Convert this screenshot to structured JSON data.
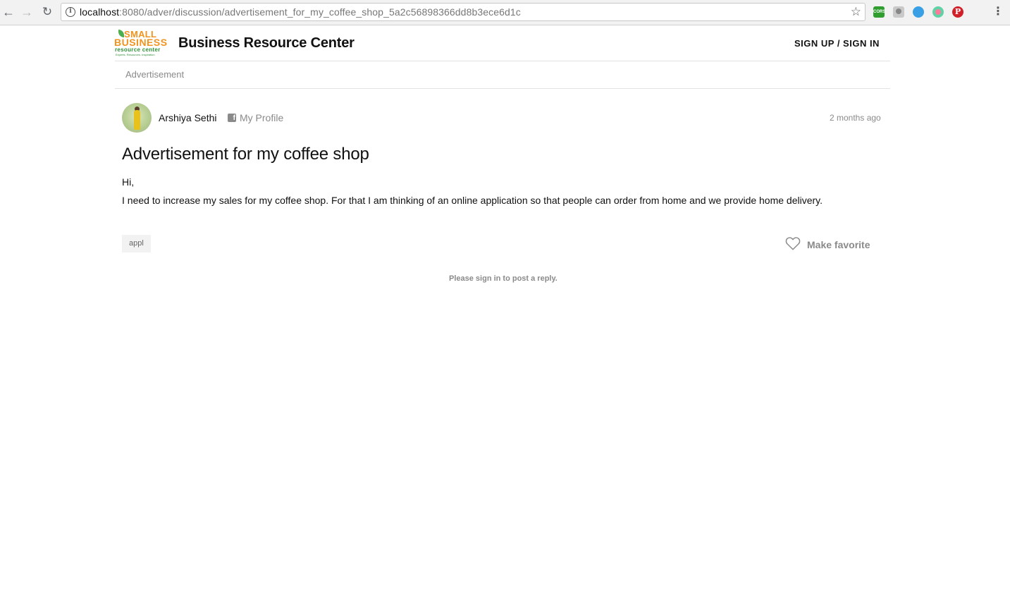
{
  "browser": {
    "url_host": "localhost",
    "url_path": ":8080/adver/discussion/advertisement_for_my_coffee_shop_5a2c56898366dd8b3ece6d1c",
    "ext1_label": "CORS",
    "ext5_label": "P",
    "icons": [
      "back-arrow-icon",
      "forward-arrow-icon",
      "reload-icon",
      "info-icon",
      "star-icon",
      "kebab-menu-icon"
    ]
  },
  "header": {
    "logo": {
      "line1": "SMALL",
      "line2": "BUSINESS",
      "line3": "resource center",
      "line4": "Experts. Resources. Inspiration"
    },
    "title": "Business Resource Center",
    "signin": "SIGN UP / SIGN IN"
  },
  "breadcrumb": "Advertisement",
  "post": {
    "author": "Arshiya Sethi",
    "profile_link": "My Profile",
    "time": "2 months ago",
    "title": "Advertisement for my coffee shop",
    "body": [
      "Hi,",
      "I need to increase my sales for my coffee shop. For that I am thinking of an online application so that people can order from home and we provide home delivery."
    ],
    "tag": "appl",
    "favorite_label": "Make favorite",
    "reply_note": "Please sign in to post a reply."
  },
  "colors": {
    "logo_orange": "#f0931f",
    "logo_green": "#2f8f3a",
    "muted_text": "#8a8a8a"
  }
}
